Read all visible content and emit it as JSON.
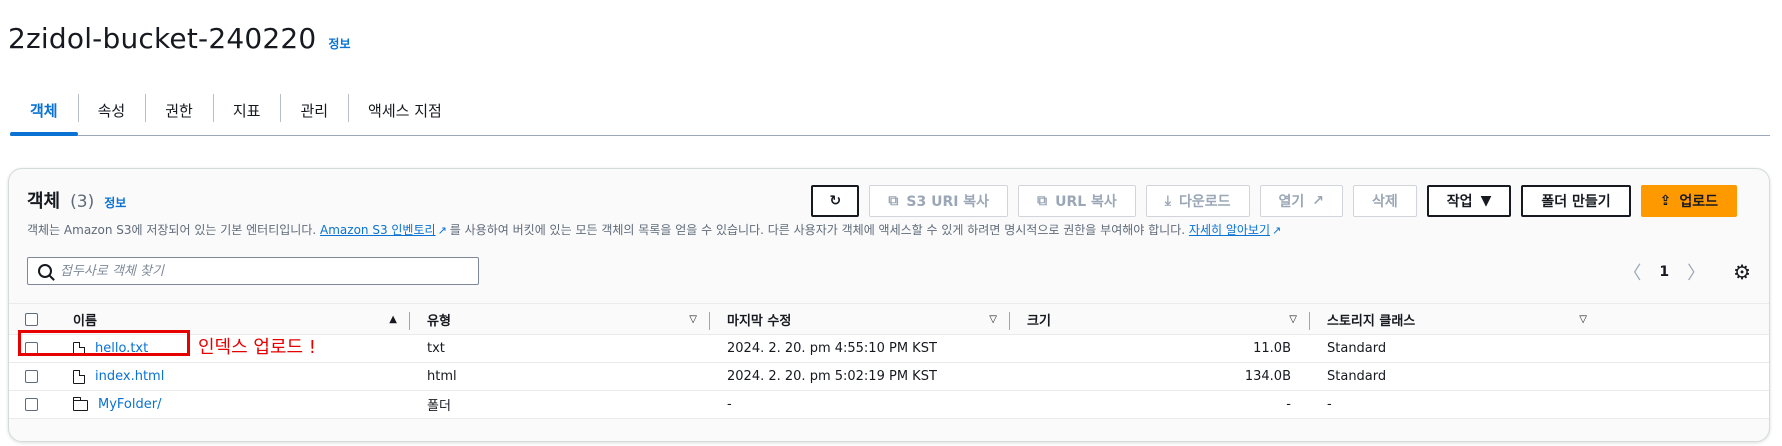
{
  "header": {
    "title": "2zidol-bucket-240220",
    "info": "정보"
  },
  "tabs": [
    {
      "label": "객체",
      "active": true
    },
    {
      "label": "속성"
    },
    {
      "label": "권한"
    },
    {
      "label": "지표"
    },
    {
      "label": "관리"
    },
    {
      "label": "액세스 지점"
    }
  ],
  "objects": {
    "title": "객체",
    "count": "(3)",
    "info": "정보",
    "desc_pre": "객체는 Amazon S3에 저장되어 있는 기본 엔터티입니다.",
    "desc_link1": "Amazon S3 인벤토리",
    "desc_mid": "를 사용하여 버킷에 있는 모든 객체의 목록을 얻을 수 있습니다. 다른 사용자가 객체에 액세스할 수 있게 하려면 명시적으로 권한을 부여해야 합니다.",
    "desc_link2": "자세히 알아보기",
    "buttons": {
      "copy_s3_uri": "S3 URI 복사",
      "copy_url": "URL 복사",
      "download": "다운로드",
      "open": "열기",
      "delete": "삭제",
      "actions": "작업",
      "create_folder": "폴더 만들기",
      "upload": "업로드"
    },
    "search_placeholder": "접두사로 객체 찾기",
    "page": "1",
    "columns": {
      "name": "이름",
      "type": "유형",
      "modified": "마지막 수정",
      "size": "크기",
      "storage_class": "스토리지 클래스"
    },
    "rows": [
      {
        "name": "hello.txt",
        "type": "txt",
        "modified": "2024. 2. 20. pm 4:55:10 PM KST",
        "size": "11.0B",
        "storage_class": "Standard",
        "icon": "file-icon"
      },
      {
        "name": "index.html",
        "type": "html",
        "modified": "2024. 2. 20. pm 5:02:19 PM KST",
        "size": "134.0B",
        "storage_class": "Standard",
        "icon": "file-icon"
      },
      {
        "name": "MyFolder/",
        "type": "폴더",
        "modified": "-",
        "size": "-",
        "storage_class": "-",
        "icon": "folder-icon"
      }
    ]
  },
  "annotation": {
    "text": "인덱스 업로드 !",
    "color": "#e60000"
  },
  "colors": {
    "accent": "#0972d3",
    "primary_button": "#ff9900"
  }
}
